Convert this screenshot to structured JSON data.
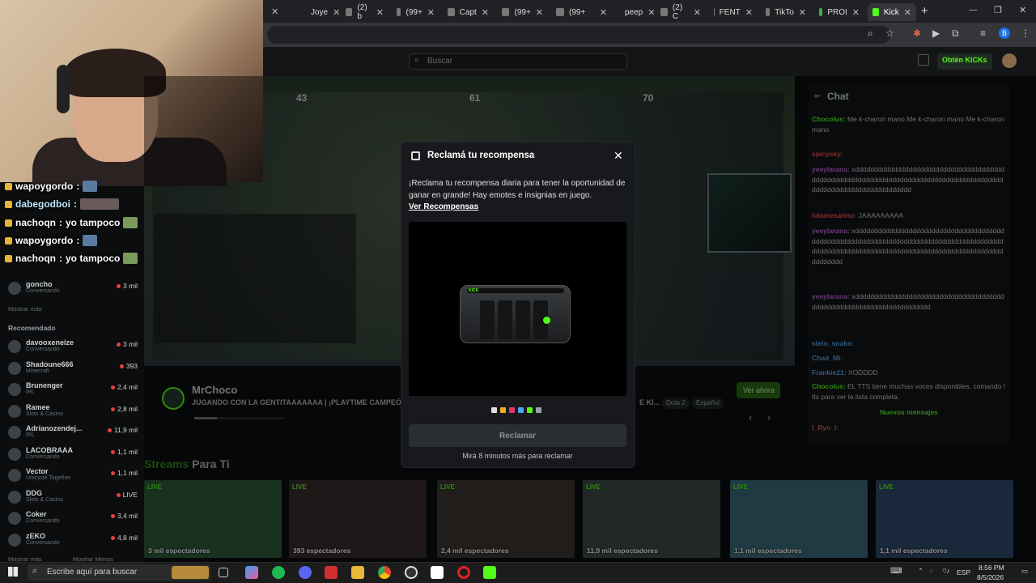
{
  "browser": {
    "tabs": [
      {
        "label": "Joye",
        "icon": "tab-favicon"
      },
      {
        "label": "(2) b",
        "icon": "x-icon"
      },
      {
        "label": "(99+",
        "icon": "tiktok-icon"
      },
      {
        "label": "Capt",
        "icon": "capcut-icon"
      },
      {
        "label": "(99+",
        "icon": "tiktok-icon"
      },
      {
        "label": "(99+",
        "icon": "tiktok-icon"
      },
      {
        "label": "peep",
        "icon": "tab-favicon"
      },
      {
        "label": "(2) C",
        "icon": "x-icon"
      },
      {
        "label": "FENT",
        "icon": "tiktok-icon"
      },
      {
        "label": "TikTo",
        "icon": "tiktok-icon"
      },
      {
        "label": "PROI",
        "icon": "shield-icon"
      },
      {
        "label": "Kick",
        "icon": "kick-icon",
        "active": true
      }
    ],
    "new_tab": "+",
    "window_controls": [
      "—",
      "❐",
      "✕"
    ],
    "profile_letter": "B"
  },
  "site": {
    "search_placeholder": "Buscar",
    "obtain_kicks": "Obtén KICKs",
    "chat_title": "Chat"
  },
  "overlay_chat": [
    {
      "user": "wapoygordo",
      "text": ""
    },
    {
      "user": "dabegodboi",
      "text": ""
    },
    {
      "user": "nachoqn",
      "text": "yo tampoco"
    },
    {
      "user": "wapoygordo",
      "text": ""
    },
    {
      "user": "nachoqn",
      "text": "yo tampoco"
    }
  ],
  "sidebar": {
    "followed": [
      {
        "name": "goncho",
        "category": "Conversando",
        "viewers": "3 mil"
      }
    ],
    "show_more": "Mostrar más",
    "recommended_heading": "Recomendado",
    "recommended": [
      {
        "name": "davooxeneize",
        "category": "Conversando",
        "viewers": "3 mil"
      },
      {
        "name": "Shadoune666",
        "category": "Minecraft",
        "viewers": "393"
      },
      {
        "name": "Brunenger",
        "category": "IRL",
        "viewers": "2,4 mil"
      },
      {
        "name": "Ramee",
        "category": "Slots & Casino",
        "viewers": "2,8 mil"
      },
      {
        "name": "Adrianozendej...",
        "category": "IRL",
        "viewers": "11,9 mil"
      },
      {
        "name": "LACOBRAAA",
        "category": "Conversando",
        "viewers": "1,1 mil"
      },
      {
        "name": "Vector",
        "category": "Unicycle Together",
        "viewers": "1,1 mil"
      },
      {
        "name": "DDG",
        "category": "Slots & Casino",
        "viewers": "LIVE"
      },
      {
        "name": "Coker",
        "category": "Conversando",
        "viewers": "3,4 mil"
      },
      {
        "name": "zEKO",
        "category": "Conversando",
        "viewers": "4,8 mil"
      }
    ],
    "show_more_bottom": "Mostrar más",
    "show_less_bottom": "Mostrar Menos"
  },
  "stream": {
    "hud_left": "43",
    "hud_mid": "61",
    "hud_right": "70",
    "streamer": "MrChoco",
    "title": "JUGANDO CON LA GENTITAAAAAAA | ¡PLAYTIME CAMPEÓN",
    "title_tail": "E KI...",
    "tags": [
      "Dota 2",
      "Español"
    ],
    "watch_now": "Ver ahora"
  },
  "streams_for_you": {
    "title_a": "Streams",
    "title_b": "Para Ti",
    "items": [
      {
        "live": "LIVE",
        "viewers": "3 mil espectadores",
        "color": "#2f5a3a"
      },
      {
        "live": "LIVE",
        "viewers": "393 espectadores",
        "color": "#3a2c2c"
      },
      {
        "live": "LIVE",
        "viewers": "2,4 mil espectadores",
        "color": "#3b3530"
      },
      {
        "live": "LIVE",
        "viewers": "11,9 mil espectadores",
        "color": "#3f4a45"
      },
      {
        "live": "LIVE",
        "viewers": "1,1 mil espectadores",
        "color": "#3a6a7a"
      },
      {
        "live": "LIVE",
        "viewers": "1,1 mil espectadores",
        "color": "#2f4a6a"
      }
    ]
  },
  "chat": {
    "messages": [
      {
        "user": "Chocolus:",
        "text": "Me k-charon mano Me k-charon mano Me k-charon mano",
        "color": "#53fc18"
      },
      {
        "user": "spicysky:",
        "text": "",
        "color": "#e05a5a"
      },
      {
        "user": "yeeylarana:",
        "text": "xddddddddddddddddddddddddddddddddddddddddddddddddddddddddddddddddddddddddddddddddddddddddddddddddddddddddddddddddddd",
        "color": "#c06ad8"
      },
      {
        "user": "lolamesarino:",
        "text": "JAAAAAAAAA",
        "color": "#e05a5a"
      },
      {
        "user": "yeeylarana:",
        "text": "xddddddddddddddddddddddddddddddddddddddddddddddddddddddddddddddddddddddddddddddddddddddddddddddddddddddddddddddddddddddddddddddddddddddddddddddddddd",
        "color": "#c06ad8"
      },
      {
        "user": "yeeylarana:",
        "text": "xdddddddddddddddddddddddddddddddddddddddddddddddddddddddddddddddddddddd",
        "color": "#c06ad8"
      },
      {
        "user": "stelo_snake:",
        "text": "",
        "color": "#5aa0e0"
      },
      {
        "user": "Chad_Mi:",
        "text": "",
        "color": "#5aa0e0"
      },
      {
        "user": "Frankie21:",
        "text": "XODDDD",
        "color": "#5aa0e0"
      },
      {
        "user": "Chocolus:",
        "text": "EL TTS tiene muchas voces disponibles, comando !tts para ver la lista completa.",
        "color": "#53fc18"
      }
    ],
    "new_messages": "Nuevos mensajes",
    "last_user": "I_Ryn_I:"
  },
  "modal": {
    "title": "Reclamá tu recompensa",
    "body": "¡Reclama tu recompensa diaria para tener la oportunidad de ganar en grande! Hay emotes e insignias en juego.",
    "link": "Ver Recompensas",
    "device_label": "KICK",
    "dot_colors": [
      "#e0e0e0",
      "#f0b020",
      "#e8336a",
      "#4aa8f0",
      "#53fc18",
      "#9aa0a6"
    ],
    "claim_button": "Reclamar",
    "footer": "Mirá 8 minutos más para reclamar"
  },
  "taskbar": {
    "search_placeholder": "Escribe aquí para buscar",
    "time": "8:56 PM",
    "date": "8/5/2026",
    "language": "ESP"
  }
}
